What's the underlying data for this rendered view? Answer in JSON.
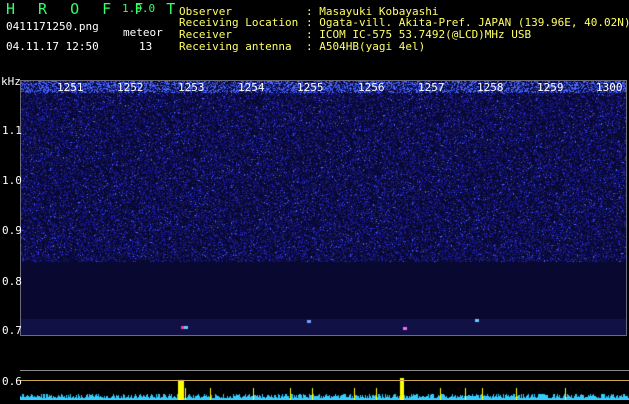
{
  "header": {
    "logo": "H R O F F T",
    "version": "1.0.0",
    "filename": "0411171250.png",
    "datetime": "04.11.17 12:50",
    "meteor_label": "meteor",
    "meteor_count": "13"
  },
  "info": {
    "observer_label": "Observer",
    "observer_value": ": Masayuki Kobayashi",
    "location_label": "Receiving Location",
    "location_value": ": Ogata-vill. Akita-Pref. JAPAN (139.96E, 40.02N)",
    "receiver_label": "Receiver",
    "receiver_value": ": ICOM IC-575 53.7492(@LCD)MHz USB",
    "antenna_label": "Receiving antenna",
    "antenna_value": ": A504HB(yagi 4el)"
  },
  "axis": {
    "y_unit": "kHz",
    "x_ticks": [
      "1251",
      "1252",
      "1253",
      "1254",
      "1255",
      "1256",
      "1257",
      "1258",
      "1259",
      "1300"
    ],
    "y_ticks": [
      "1.1",
      "1.0",
      "0.9",
      "0.8",
      "0.7",
      "0.6"
    ]
  },
  "colors": {
    "header_green": "#33ff66",
    "header_yellow": "#ffff66",
    "spectrogram_bg": "#0a0a3a",
    "signal_cyan": "#33ccff",
    "meteor_yellow": "#ffff00"
  }
}
